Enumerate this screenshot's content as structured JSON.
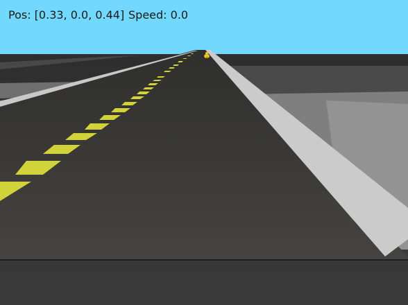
{
  "hud": {
    "pos_label": "Pos: [0.33, 0.0, 0.44]",
    "speed_label": "Speed: 0.0"
  },
  "colors": {
    "sky": "#72d8fe",
    "ground": "#3a3a3a",
    "asphalt": "#383734",
    "lane_yellow": "#d2d23a",
    "lane_white": "#c8c8c8"
  },
  "scene": {
    "description_icons": [
      "road-surface",
      "yellow-dashed-centerline",
      "white-edge-line",
      "duckie-obstacle"
    ]
  }
}
